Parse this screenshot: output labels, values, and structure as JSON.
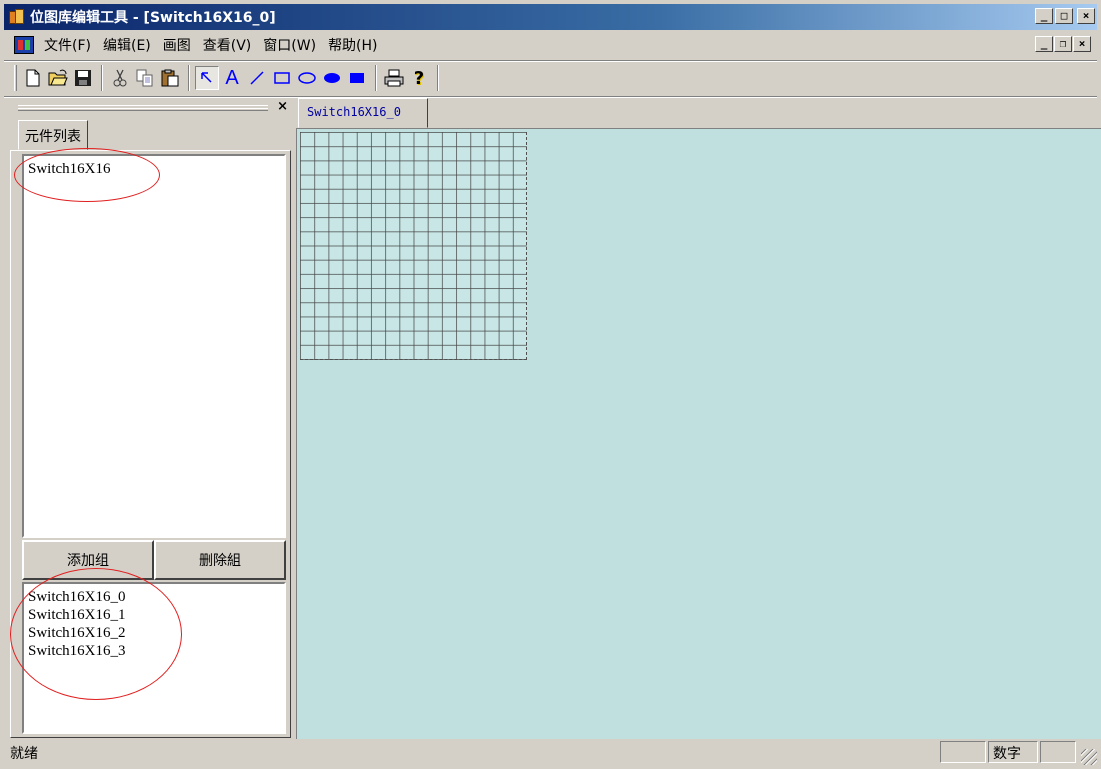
{
  "window": {
    "title": "位图库编辑工具 - [Switch16X16_0]",
    "caption_buttons": {
      "minimize": "_",
      "maximize": "□",
      "close": "×"
    },
    "mdi_buttons": {
      "minimize": "_",
      "restore": "❐",
      "close": "×"
    }
  },
  "menu": {
    "items": [
      "文件(F)",
      "编辑(E)",
      "画图",
      "查看(V)",
      "窗口(W)",
      "帮助(H)"
    ]
  },
  "toolbar": {
    "icons": [
      "new-file-icon",
      "open-folder-icon",
      "save-icon",
      "cut-icon",
      "copy-icon",
      "paste-icon",
      "select-arrow-icon",
      "text-tool-icon",
      "line-tool-icon",
      "rectangle-tool-icon",
      "ellipse-tool-icon",
      "filled-ellipse-tool-icon",
      "filled-rectangle-tool-icon",
      "print-icon",
      "help-icon"
    ],
    "text_tool_glyph": "A",
    "help_glyph": "?",
    "accent_color": "#0000ff"
  },
  "panel": {
    "close_glyph": "×",
    "tab_label": "元件列表",
    "component_list": [
      "Switch16X16"
    ],
    "add_group_label": "添加组",
    "delete_group_label": "删除組",
    "bitmap_list": [
      "Switch16X16_0",
      "Switch16X16_1",
      "Switch16X16_2",
      "Switch16X16_3"
    ]
  },
  "document": {
    "tab_label": "Switch16X16_0",
    "canvas_color": "#c0dfdf",
    "grid_cells": 16
  },
  "status": {
    "text": "就绪",
    "panes": [
      "",
      "数字",
      ""
    ]
  }
}
